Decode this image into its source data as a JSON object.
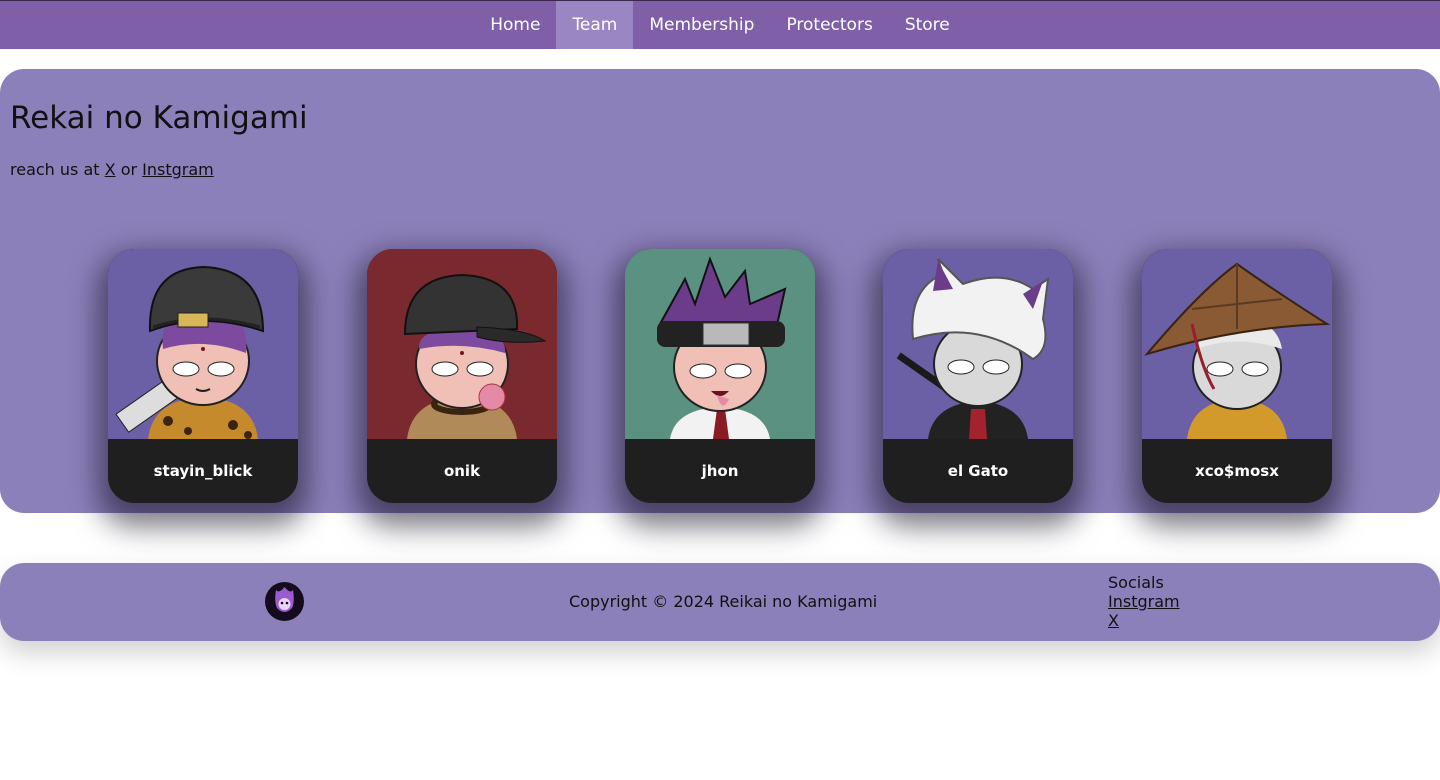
{
  "nav": {
    "items": [
      {
        "label": "Home"
      },
      {
        "label": "Team",
        "active": true
      },
      {
        "label": "Membership"
      },
      {
        "label": "Protectors"
      },
      {
        "label": "Store"
      }
    ]
  },
  "hero": {
    "title": "Rekai no Kamigami",
    "reach_prefix": "reach us at",
    "reach_x": "X",
    "reach_or": "or",
    "reach_instagram": "Instgram"
  },
  "team": [
    {
      "name": "stayin_blick",
      "bg_color": "#6b5fa5"
    },
    {
      "name": "onik",
      "bg_color": "#7a2a2e"
    },
    {
      "name": "jhon",
      "bg_color": "#5b9181"
    },
    {
      "name": "el Gato",
      "bg_color": "#6b5fa5"
    },
    {
      "name": "xco$mosx",
      "bg_color": "#6b5fa5"
    }
  ],
  "footer": {
    "logo_icon": "flame-skull-icon",
    "copyright": "Copyright © 2024 Reikai no Kamigami",
    "socials_heading": "Socials",
    "socials_instagram": "Instgram",
    "socials_x": "X"
  },
  "colors": {
    "nav_bg": "#7f5fa8",
    "nav_active": "#9b86c4",
    "panel_bg": "#8c80ba",
    "card_footer": "#1f1f1f"
  }
}
